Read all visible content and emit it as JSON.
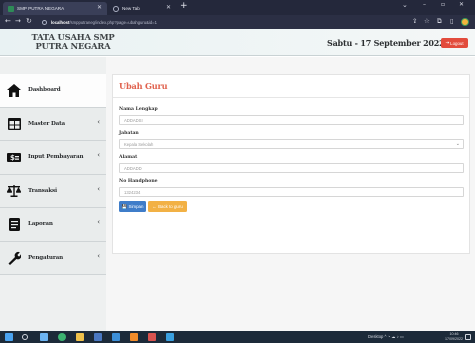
{
  "browser": {
    "tabs": [
      {
        "label": "SMP PUTRA NEGARA",
        "active": true
      },
      {
        "label": "New Tab",
        "active": false
      }
    ],
    "url_host": "localhost",
    "url_path": "/smpputraneg/index.php?page=ubahguru&id=1"
  },
  "header": {
    "brand_line1": "TATA USAHA SMP",
    "brand_line2": "PUTRA NEGARA",
    "date": "Sabtu - 17 September 2022",
    "logout_label": "Logout"
  },
  "sidebar": {
    "items": [
      {
        "label": "Dashboard",
        "icon": "home-icon",
        "has_caret": false
      },
      {
        "label": "Master Data",
        "icon": "table-icon",
        "has_caret": true
      },
      {
        "label": "Input Pembayaran",
        "icon": "money-icon",
        "has_caret": true
      },
      {
        "label": "Transaksi",
        "icon": "balance-scale-icon",
        "has_caret": true
      },
      {
        "label": "Laporan",
        "icon": "document-icon",
        "has_caret": true
      },
      {
        "label": "Pengaturan",
        "icon": "wrench-icon",
        "has_caret": true
      }
    ]
  },
  "form": {
    "title": "Ubah Guru",
    "fields": {
      "nama": {
        "label": "Nama Lengkap",
        "value": "ADDADSI"
      },
      "jabatan": {
        "label": "Jabatan",
        "value": "Kepala Sekolah"
      },
      "alamat": {
        "label": "Alamat",
        "value": "ADDADD"
      },
      "hp": {
        "label": "No Handphone",
        "value": "1324234"
      }
    },
    "save_label": "Simpan",
    "back_label": "Back to guru"
  },
  "taskbar": {
    "tray_text": "Desktop",
    "time": "10:46",
    "date": "17/09/2022"
  },
  "colors": {
    "accent_title": "#e0614d",
    "logout_red": "#e24b3c",
    "save_blue": "#3f7dc9",
    "back_orange": "#f2b145"
  }
}
